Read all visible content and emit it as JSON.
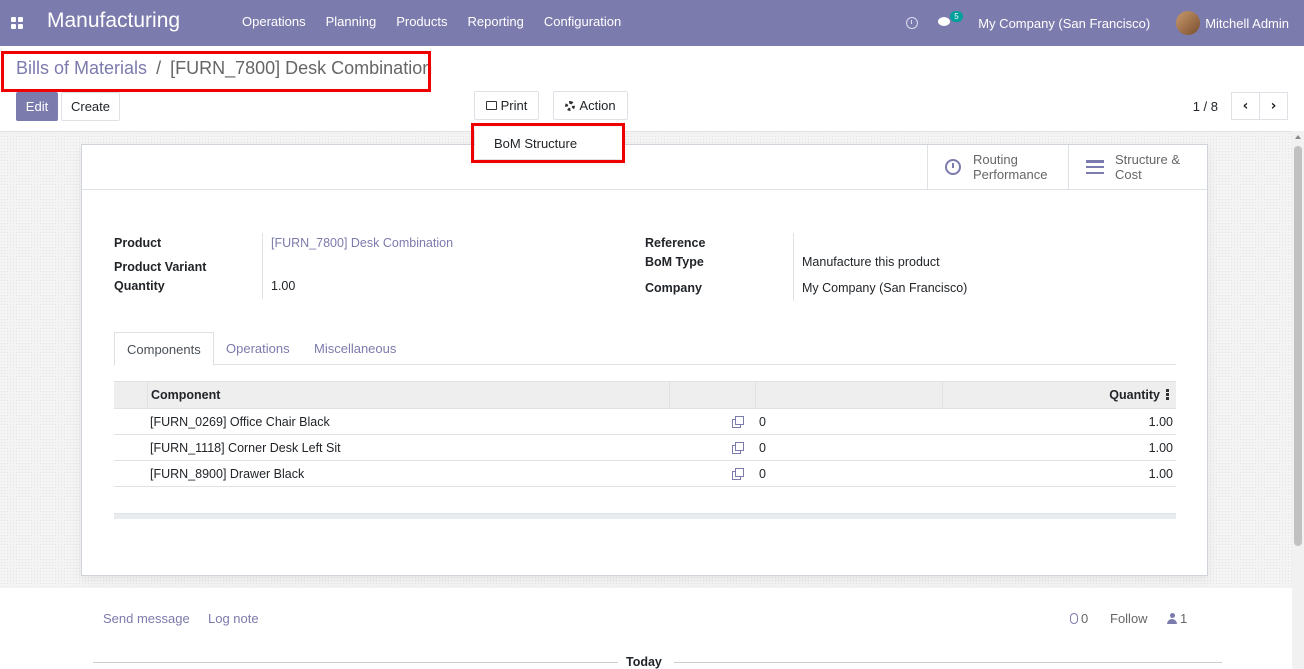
{
  "navbar": {
    "app_title": "Manufacturing",
    "menu": [
      "Operations",
      "Planning",
      "Products",
      "Reporting",
      "Configuration"
    ],
    "chat_badge": "5",
    "company": "My Company (San Francisco)",
    "user": "Mitchell Admin",
    "color": "#7c7bad"
  },
  "breadcrumb": {
    "parent": "Bills of Materials",
    "separator": "/",
    "current": "[FURN_7800] Desk Combination"
  },
  "toolbar": {
    "edit_label": "Edit",
    "create_label": "Create",
    "print_label": "Print",
    "action_label": "Action",
    "pager": "1 / 8"
  },
  "print_menu": {
    "items": [
      "BoM Structure"
    ]
  },
  "stat_buttons": {
    "routing_line1": "Routing",
    "routing_line2": "Performance",
    "structure_line1": "Structure &",
    "structure_line2": "Cost"
  },
  "form": {
    "product_label": "Product",
    "product_value": "[FURN_7800] Desk Combination",
    "variant_label": "Product Variant",
    "quantity_label": "Quantity",
    "quantity_value": "1.00",
    "reference_label": "Reference",
    "bom_type_label": "BoM Type",
    "bom_type_value": "Manufacture this product",
    "company_label": "Company",
    "company_value": "My Company (San Francisco)"
  },
  "tabs": [
    "Components",
    "Operations",
    "Miscellaneous"
  ],
  "components_table": {
    "header_component": "Component",
    "header_quantity": "Quantity",
    "rows": [
      {
        "component": "[FURN_0269] Office Chair Black",
        "avail": "0",
        "quantity": "1.00"
      },
      {
        "component": "[FURN_1118] Corner Desk Left Sit",
        "avail": "0",
        "quantity": "1.00"
      },
      {
        "component": "[FURN_8900] Drawer Black",
        "avail": "0",
        "quantity": "1.00"
      }
    ]
  },
  "chatter": {
    "send_message": "Send message",
    "log_note": "Log note",
    "attachments": "0",
    "follow": "Follow",
    "followers": "1",
    "today": "Today"
  }
}
